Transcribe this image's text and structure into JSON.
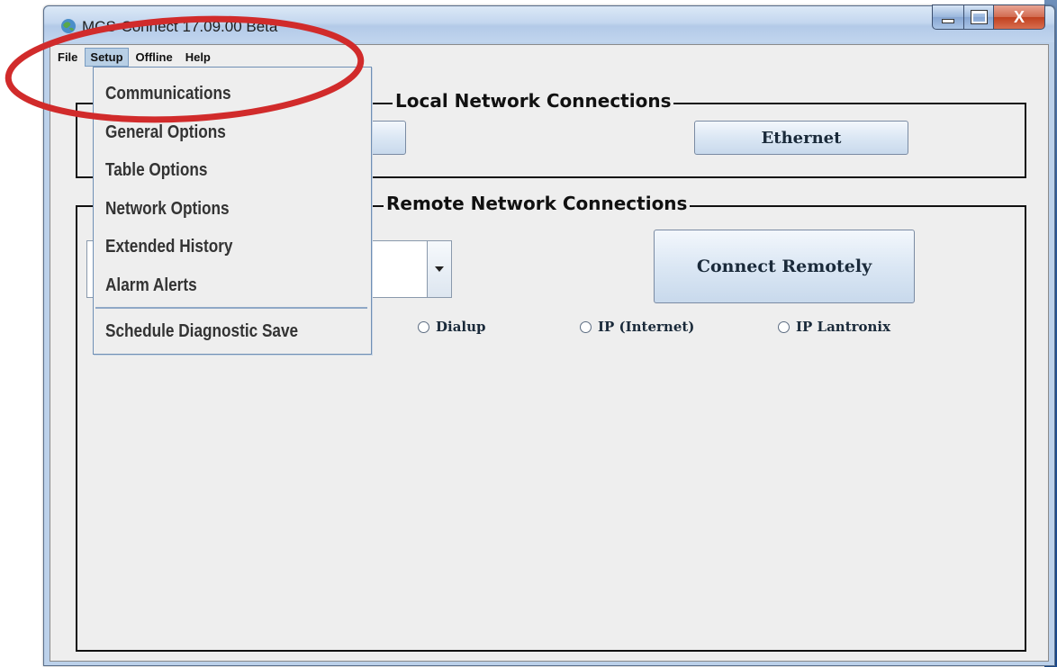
{
  "window": {
    "title": "MCS-Connect 17.09.00 Beta"
  },
  "title_buttons": {
    "close_label": "X"
  },
  "menubar": {
    "items": [
      "File",
      "Setup",
      "Offline",
      "Help"
    ],
    "active": "Setup"
  },
  "setup_menu": {
    "items": [
      "Communications",
      "General Options",
      "Table Options",
      "Network Options",
      "Extended History",
      "Alarm Alerts"
    ],
    "after_separator": "Schedule Diagnostic Save"
  },
  "local": {
    "title": "Local Network Connections",
    "ethernet_button": "Ethernet"
  },
  "remote": {
    "title": "Remote Network Connections",
    "connect_button": "Connect Remotely",
    "radios": [
      "Dialup",
      "IP (Internet)",
      "IP Lantronix"
    ]
  },
  "colors": {
    "annotation": "#d12b2b",
    "menu_highlight": "#b8cfe5"
  }
}
